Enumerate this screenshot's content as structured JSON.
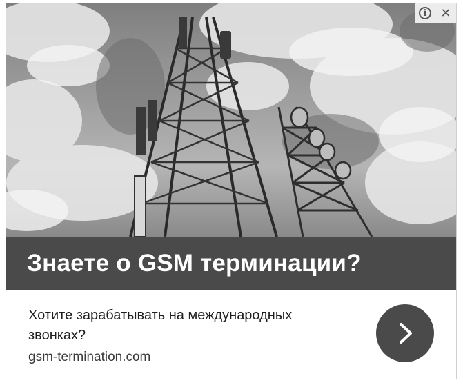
{
  "ad": {
    "headline": "Знаете о GSM терминации?",
    "description": "Хотите зарабатывать на международных звонках?",
    "domain": "gsm-termination.com",
    "controls": {
      "info_icon": "info-icon",
      "close_icon": "close-icon",
      "close_glyph": "✕"
    },
    "cta_icon": "chevron-right-icon",
    "image_alt": "cell-tower-photo"
  },
  "colors": {
    "headline_bar": "#4a4a4a",
    "cta_button": "#4a4a4a",
    "headline_text": "#ffffff",
    "body_text": "#1e1e1e"
  }
}
